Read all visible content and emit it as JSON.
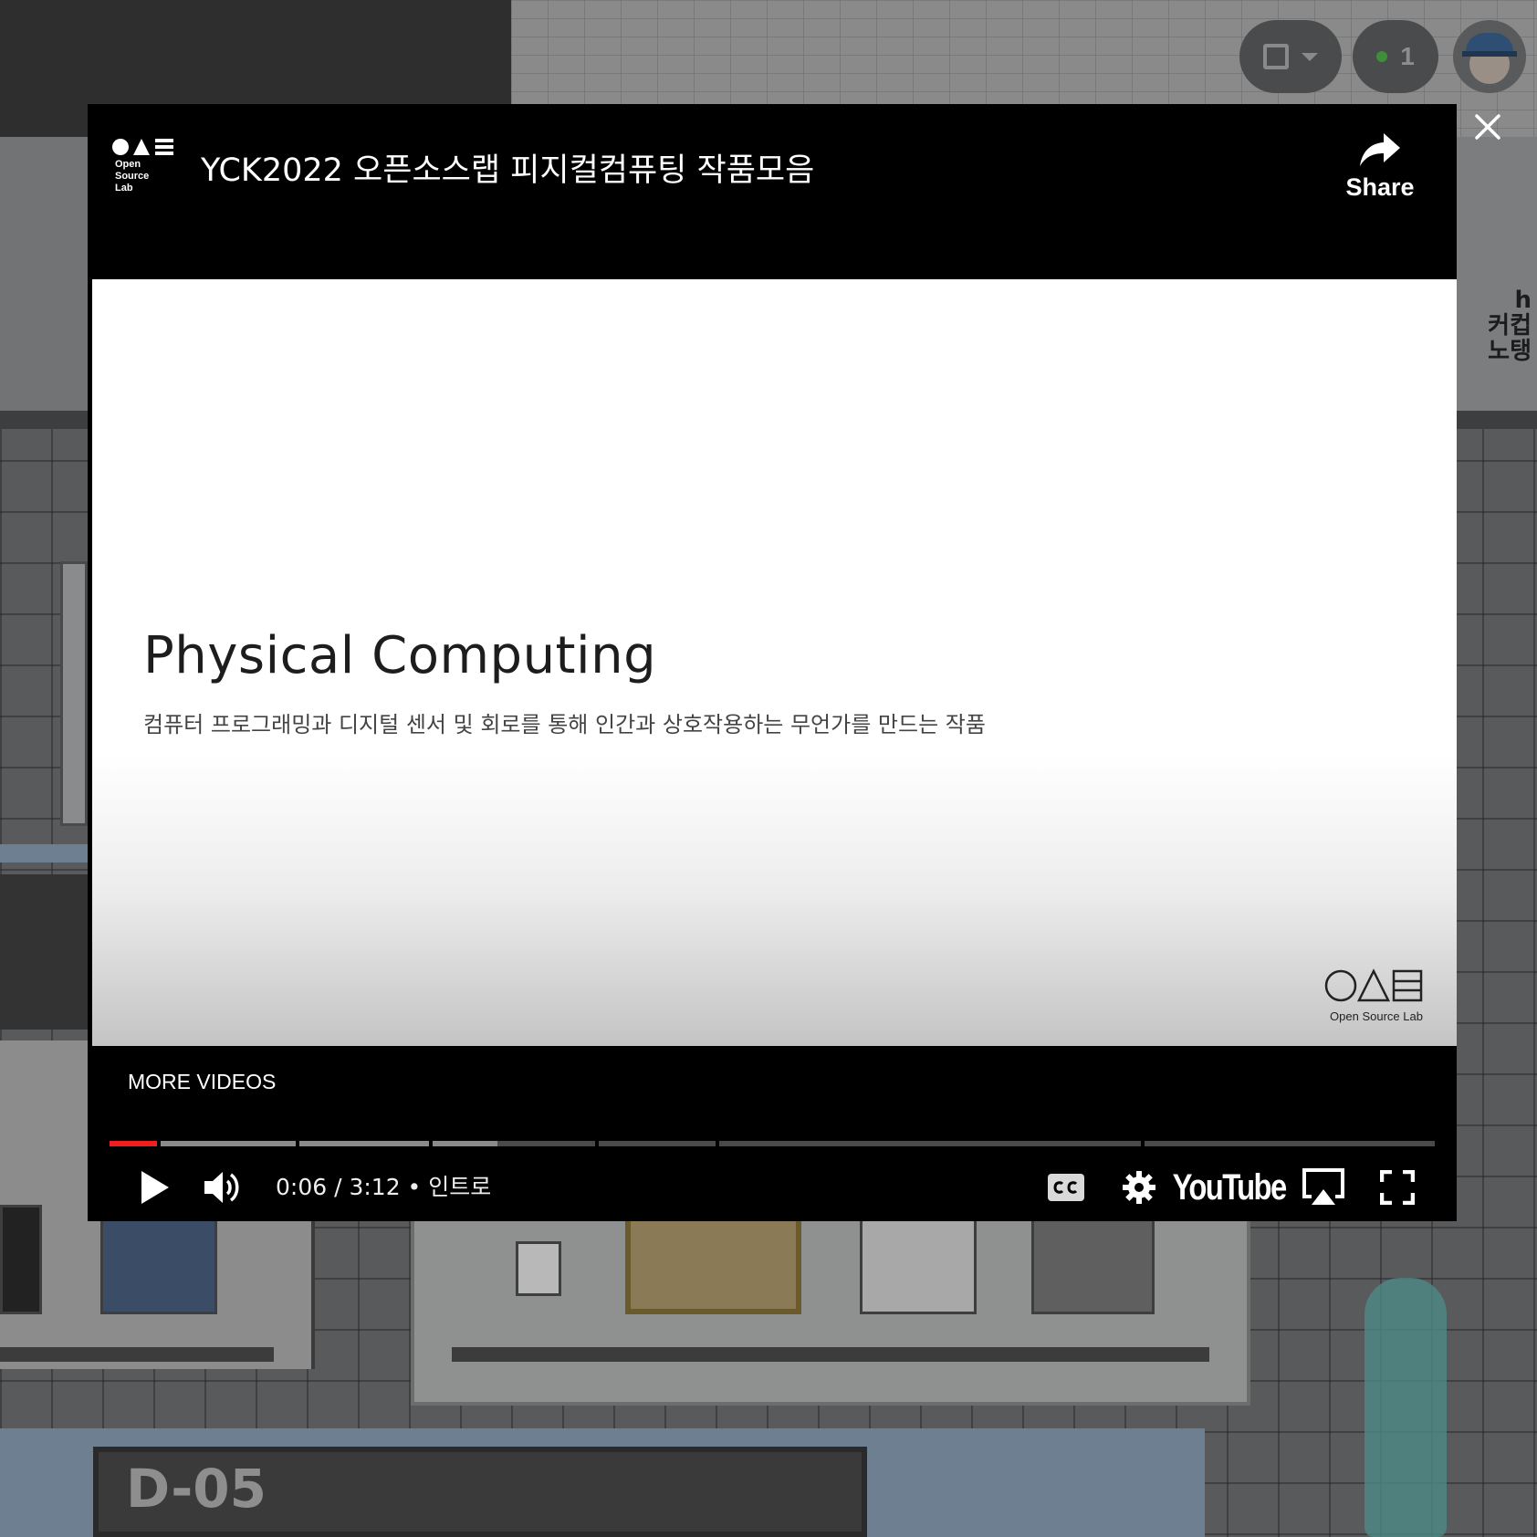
{
  "video": {
    "title": "YCK2022 오픈소스랩 피지컬컴퓨팅 작품모음",
    "channel_logo_text": "Open\nSource\nLab",
    "share_label": "Share",
    "slide_title": "Physical Computing",
    "slide_subtitle": "컴퓨터 프로그래밍과 디지털 센서 및 회로를 통해 인간과 상호작용하는 무언가를 만드는 작품",
    "slide_logo_text": "Open Source Lab",
    "more_videos_label": "MORE VIDEOS",
    "current_time": "0:06",
    "duration": "3:12",
    "chapter": "인트로",
    "time_display": "0:06 / 3:12 • 인트로",
    "played_fraction": 0.031,
    "youtube_label": "YouTube"
  },
  "hud": {
    "online_count": "1"
  },
  "world": {
    "booth_sign": "D-05",
    "right_sign": "h\n커컵\n노탱"
  },
  "icons": {
    "close": "close-icon",
    "share": "share-arrow-icon",
    "play": "play-icon",
    "volume": "volume-icon",
    "captions": "cc-icon",
    "settings": "gear-icon",
    "airplay": "airplay-icon",
    "fullscreen": "fullscreen-icon",
    "layout": "layout-square-icon"
  },
  "colors": {
    "progress_played": "#f21d1d",
    "online_dot": "#3f8f3a",
    "modal_bg": "#000000"
  }
}
